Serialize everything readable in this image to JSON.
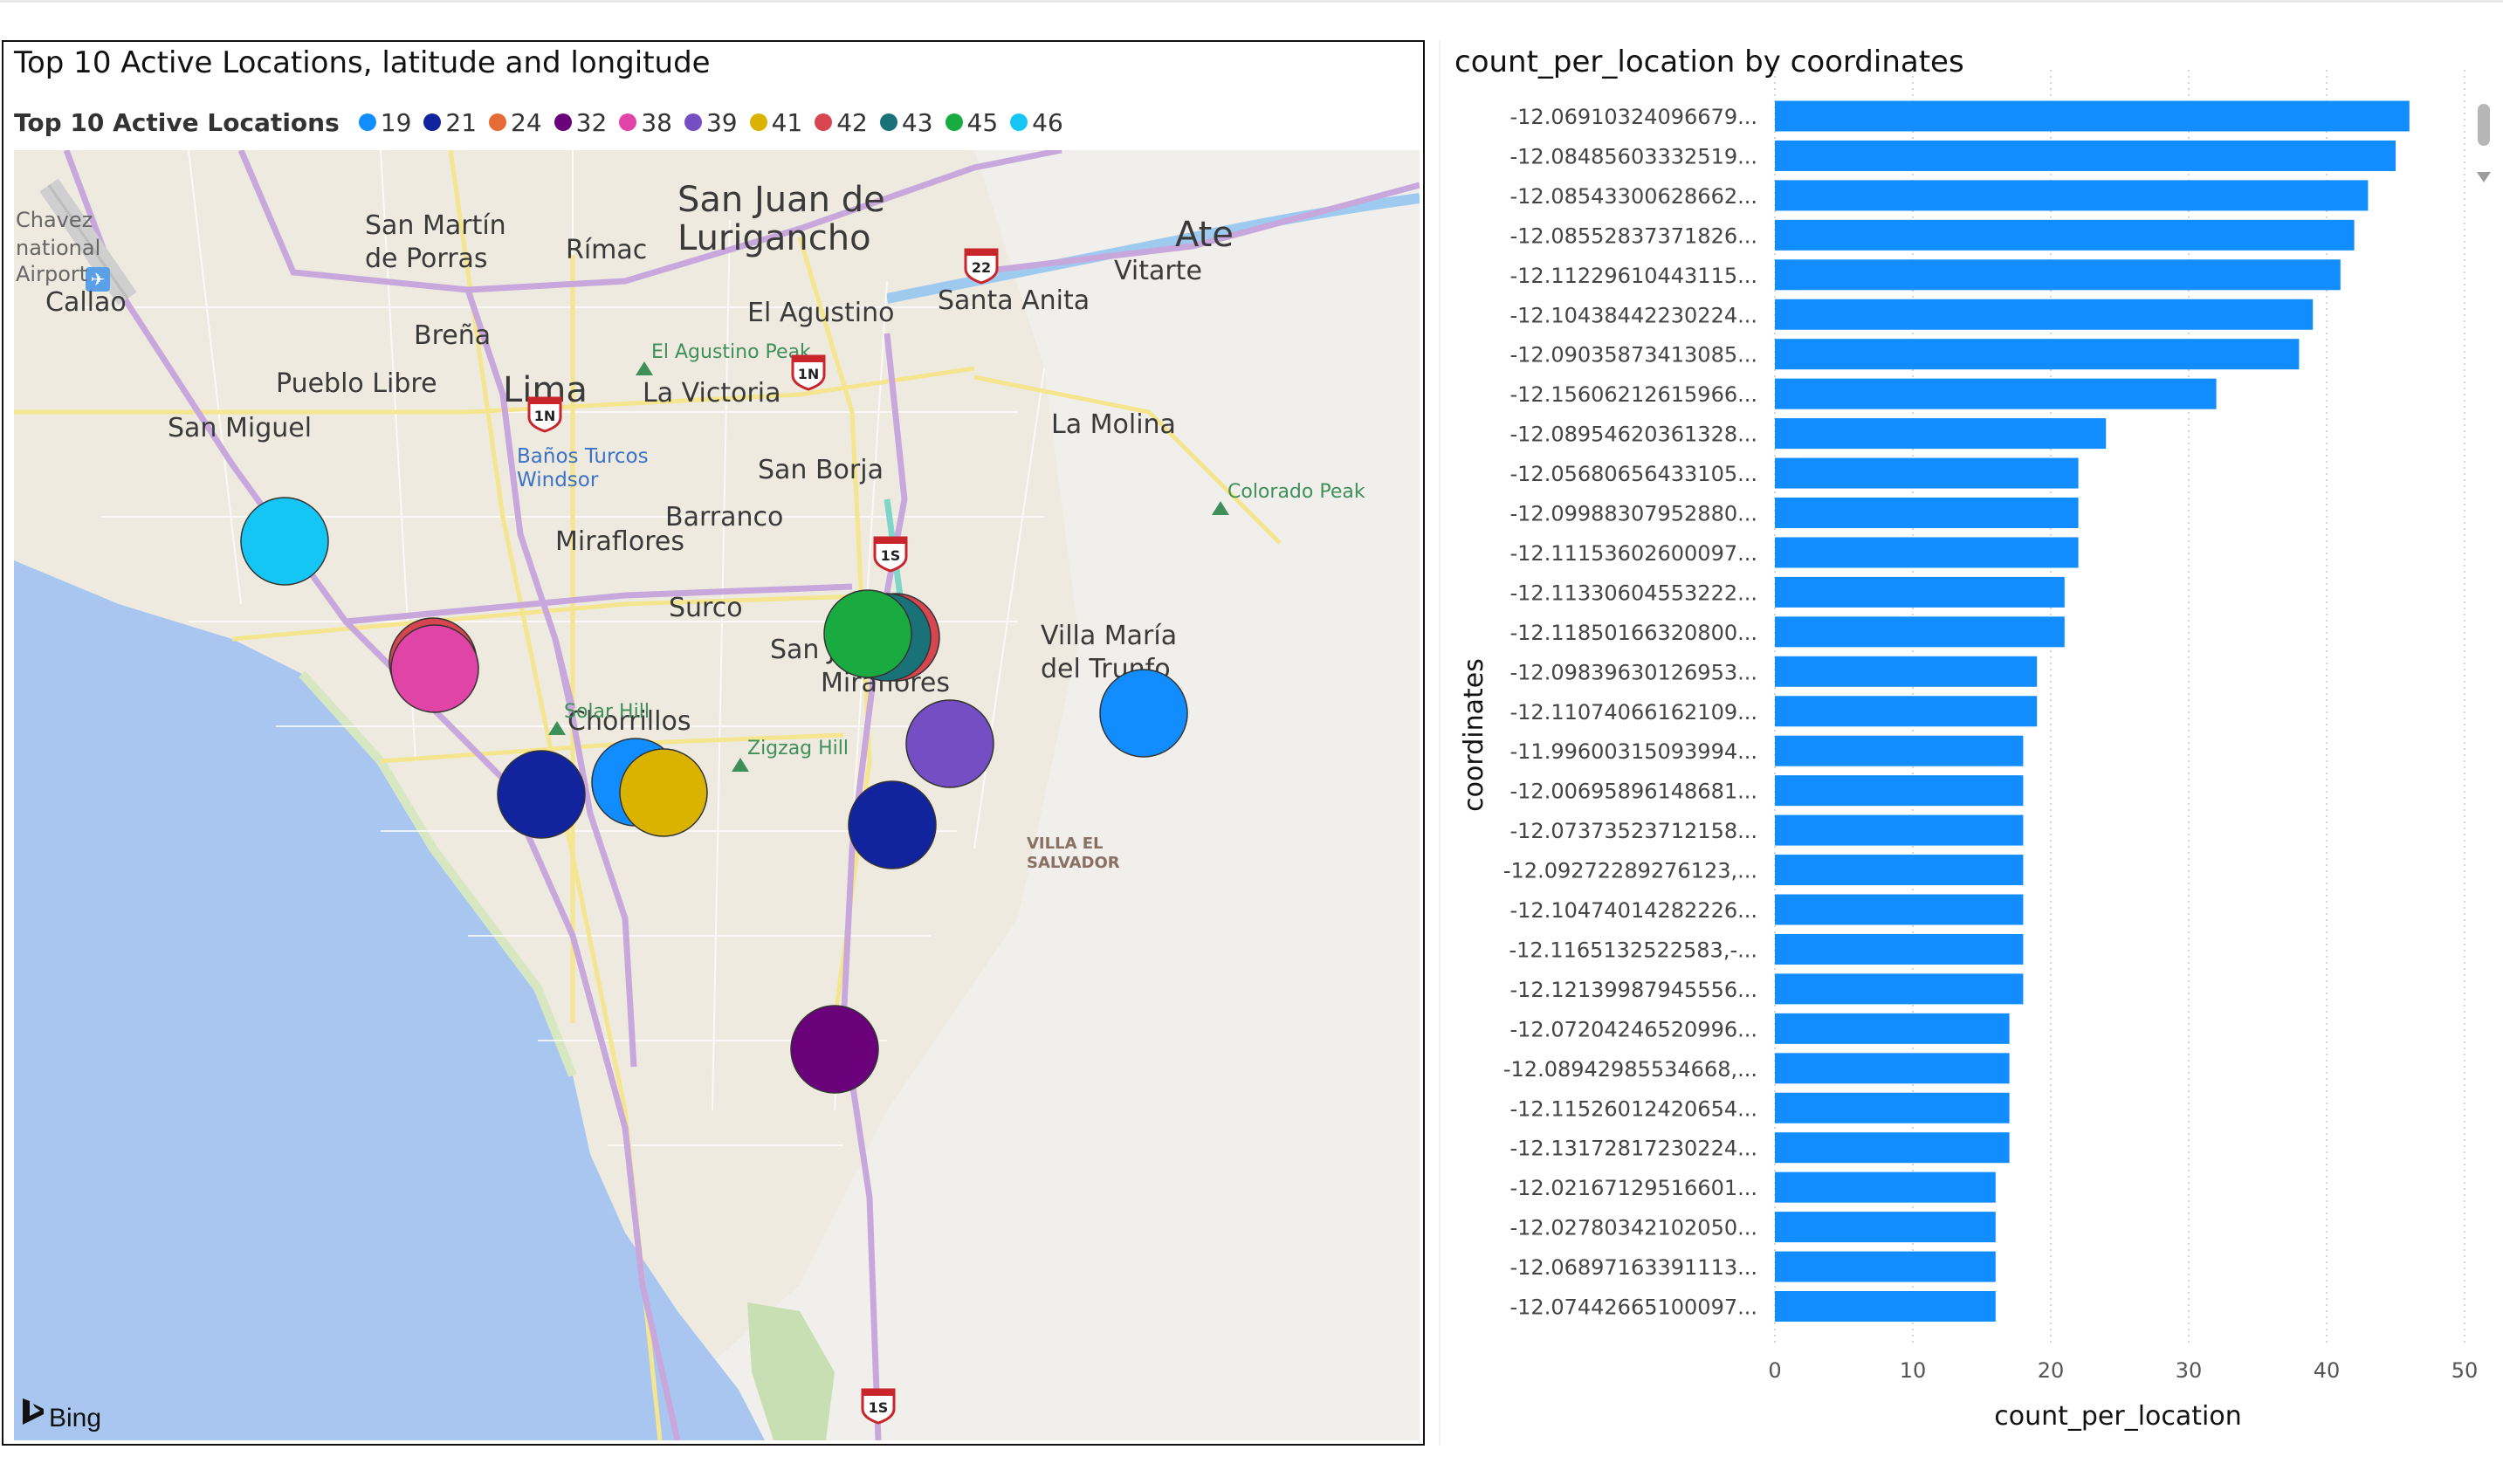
{
  "map_visual": {
    "title": "Top 10 Active Locations, latitude and longitude",
    "legend_title": "Top 10 Active Locations",
    "attribution": "Bing",
    "legend": [
      {
        "label": "19",
        "color": "#118DFF"
      },
      {
        "label": "21",
        "color": "#12239E"
      },
      {
        "label": "24",
        "color": "#E66C37"
      },
      {
        "label": "32",
        "color": "#6B007B"
      },
      {
        "label": "38",
        "color": "#E044A7"
      },
      {
        "label": "39",
        "color": "#744EC2"
      },
      {
        "label": "41",
        "color": "#D9B300"
      },
      {
        "label": "42",
        "color": "#D64550"
      },
      {
        "label": "43",
        "color": "#197278"
      },
      {
        "label": "45",
        "color": "#1AAB40"
      },
      {
        "label": "46",
        "color": "#15C6F4"
      }
    ],
    "place_labels": [
      {
        "text": "San Juan de",
        "size": "xl"
      },
      {
        "text": "Lurigancho",
        "size": "xl"
      },
      {
        "text": "Ate",
        "size": "xl"
      },
      {
        "text": "San Martín",
        "size": "l"
      },
      {
        "text": "de Porras",
        "size": "l"
      },
      {
        "text": "Rímac",
        "size": "l"
      },
      {
        "text": "Vitarte",
        "size": "l"
      },
      {
        "text": "Callao",
        "size": "l"
      },
      {
        "text": "El Agustino",
        "size": "l"
      },
      {
        "text": "Santa Anita",
        "size": "l"
      },
      {
        "text": "Breña",
        "size": "l"
      },
      {
        "text": "Pueblo Libre",
        "size": "l"
      },
      {
        "text": "Lima",
        "size": "xl"
      },
      {
        "text": "La Victoria",
        "size": "l"
      },
      {
        "text": "San Miguel",
        "size": "l"
      },
      {
        "text": "La Molina",
        "size": "l"
      },
      {
        "text": "San Borja",
        "size": "l"
      },
      {
        "text": "Miraflores",
        "size": "l"
      },
      {
        "text": "Surco",
        "size": "l"
      },
      {
        "text": "Villa María",
        "size": "l"
      },
      {
        "text": "del Trunfo",
        "size": "l"
      },
      {
        "text": "San Juan de",
        "size": "l"
      },
      {
        "text": "Miraflores",
        "size": "l"
      },
      {
        "text": "Chorrillos",
        "size": "l"
      },
      {
        "text": "Chavez",
        "size": "s"
      },
      {
        "text": "national",
        "size": "s"
      },
      {
        "text": "Airport",
        "size": "s"
      },
      {
        "text": "VILLA EL",
        "size": "xs"
      },
      {
        "text": "SALVADOR",
        "size": "xs"
      },
      {
        "text": "Barranco",
        "size": "l"
      }
    ],
    "poi_labels": [
      {
        "text": "El Agustino Peak",
        "kind": "peak"
      },
      {
        "text": "Colorado Peak",
        "kind": "peak"
      },
      {
        "text": "Solar Hill",
        "kind": "peak"
      },
      {
        "text": "Zigzag Hill",
        "kind": "peak"
      },
      {
        "text": "Baños Turcos",
        "kind": "poi"
      },
      {
        "text": "Windsor",
        "kind": "poi"
      }
    ],
    "road_shields": [
      "22",
      "1N",
      "1N",
      "1S",
      "1S"
    ],
    "markers": [
      {
        "legend": "46",
        "color": "#15C6F4"
      },
      {
        "legend": "42",
        "color": "#D64550"
      },
      {
        "legend": "38",
        "color": "#E044A7"
      },
      {
        "legend": "42",
        "color": "#D64550"
      },
      {
        "legend": "43",
        "color": "#197278"
      },
      {
        "legend": "45",
        "color": "#1AAB40"
      },
      {
        "legend": "19",
        "color": "#118DFF"
      },
      {
        "legend": "39",
        "color": "#744EC2"
      },
      {
        "legend": "21",
        "color": "#12239E"
      },
      {
        "legend": "19",
        "color": "#118DFF"
      },
      {
        "legend": "41",
        "color": "#D9B300"
      },
      {
        "legend": "21",
        "color": "#12239E"
      },
      {
        "legend": "32",
        "color": "#6B007B"
      }
    ]
  },
  "chart_data": {
    "type": "bar",
    "orientation": "horizontal",
    "title": "count_per_location by coordinates",
    "xlabel": "count_per_location",
    "ylabel": "coordinates",
    "xlim": [
      0,
      50
    ],
    "xticks": [
      0,
      10,
      20,
      30,
      40,
      50
    ],
    "grid": true,
    "bar_color": "#118DFF",
    "categories": [
      "-12.06910324096679...",
      "-12.08485603332519...",
      "-12.08543300628662...",
      "-12.08552837371826...",
      "-12.11229610443115...",
      "-12.10438442230224...",
      "-12.09035873413085...",
      "-12.15606212615966...",
      "-12.08954620361328...",
      "-12.05680656433105...",
      "-12.09988307952880...",
      "-12.11153602600097...",
      "-12.11330604553222...",
      "-12.11850166320800...",
      "-12.09839630126953...",
      "-12.11074066162109...",
      "-11.99600315093994...",
      "-12.00695896148681...",
      "-12.07373523712158...",
      "-12.09272289276123,...",
      "-12.10474014282226...",
      "-12.1165132522583,-...",
      "-12.12139987945556...",
      "-12.07204246520996...",
      "-12.08942985534668,...",
      "-12.11526012420654...",
      "-12.13172817230224...",
      "-12.02167129516601...",
      "-12.02780342102050...",
      "-12.06897163391113...",
      "-12.07442665100097..."
    ],
    "values": [
      46,
      45,
      43,
      42,
      41,
      39,
      38,
      32,
      24,
      22,
      22,
      22,
      21,
      21,
      19,
      19,
      18,
      18,
      18,
      18,
      18,
      18,
      18,
      17,
      17,
      17,
      17,
      16,
      16,
      16,
      16
    ]
  }
}
